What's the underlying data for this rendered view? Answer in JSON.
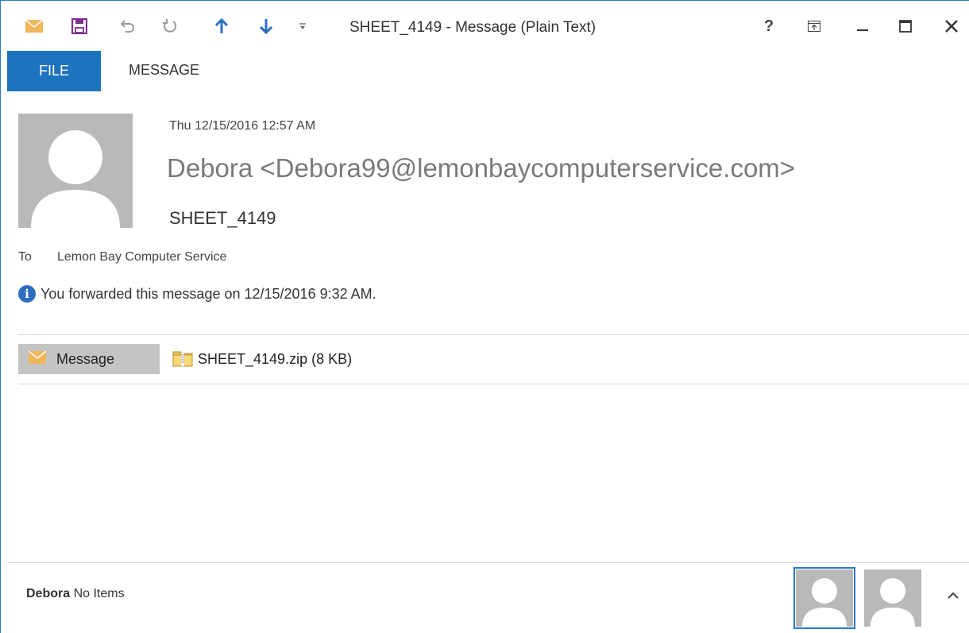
{
  "window": {
    "title": "SHEET_4149 - Message (Plain Text)",
    "help_label": "?"
  },
  "quick_access": {
    "icons": [
      "mail-icon",
      "save-icon",
      "undo-icon",
      "redo-icon",
      "previous-item-icon",
      "next-item-icon",
      "customize-toolbar-icon"
    ]
  },
  "ribbon": {
    "tabs": [
      {
        "label": "FILE",
        "active": true
      },
      {
        "label": "MESSAGE",
        "active": false
      }
    ]
  },
  "header": {
    "date": "Thu 12/15/2016 12:57 AM",
    "sender": "Debora <Debora99@lemonbaycomputerservice.com>",
    "subject": "SHEET_4149",
    "to_label": "To",
    "to_value": "Lemon Bay Computer Service",
    "info": "You forwarded this message on 12/15/2016 9:32 AM."
  },
  "attachments": {
    "message_label": "Message",
    "file": "SHEET_4149.zip (8 KB)"
  },
  "people_pane": {
    "name": "Debora",
    "status": "No Items"
  },
  "colors": {
    "accent": "#1e73be",
    "border": "#2b79c2",
    "avatar": "#b9b9b9",
    "save_icon": "#7b2f8f",
    "arrow_icon": "#2b6fc4",
    "mail_icon": "#f0b65a"
  }
}
